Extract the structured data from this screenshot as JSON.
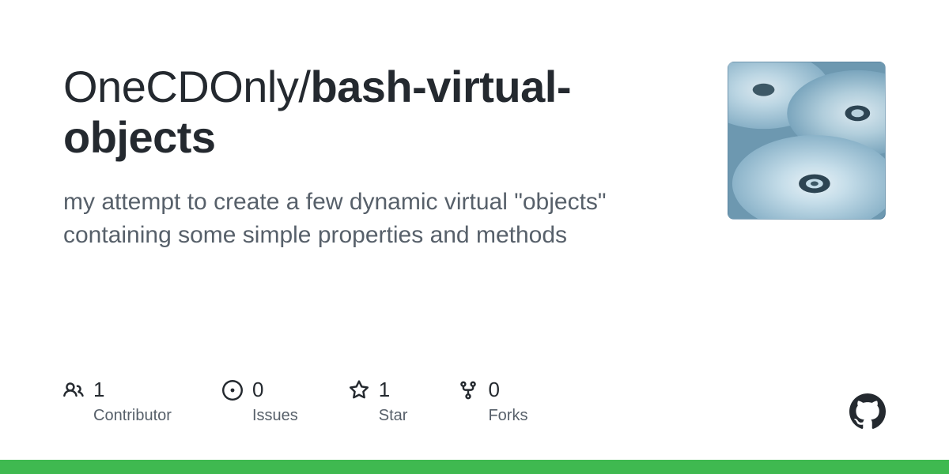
{
  "owner": "OneCDOnly",
  "repo": "bash-virtual-objects",
  "description": "my attempt to create a few dynamic virtual \"objects\" containing some simple properties and methods",
  "stats": {
    "contributors": {
      "count": "1",
      "label": "Contributor"
    },
    "issues": {
      "count": "0",
      "label": "Issues"
    },
    "stars": {
      "count": "1",
      "label": "Star"
    },
    "forks": {
      "count": "0",
      "label": "Forks"
    }
  },
  "colors": {
    "accent": "#3fb950"
  }
}
